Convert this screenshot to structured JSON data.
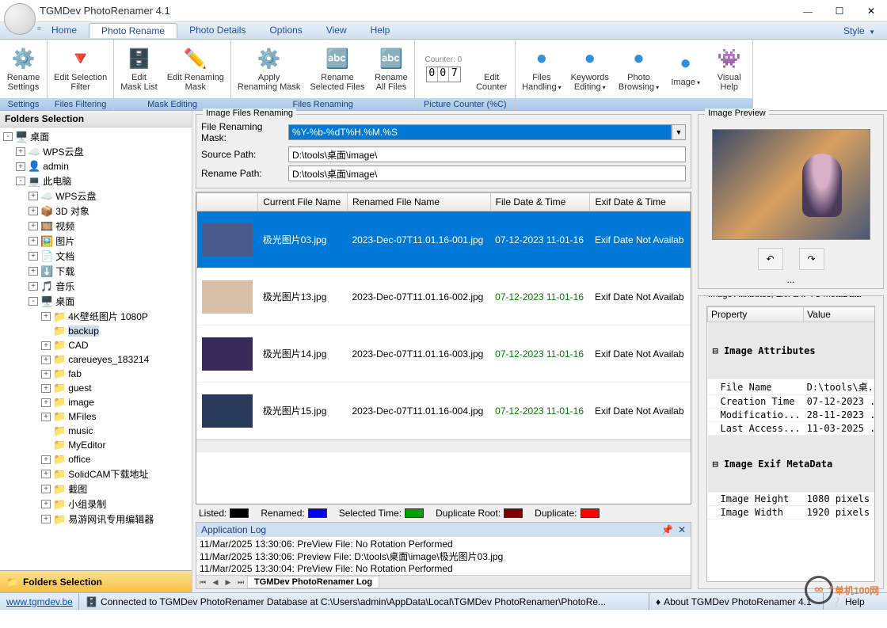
{
  "window": {
    "title": "TGMDev PhotoRenamer 4.1",
    "style_menu": "Style"
  },
  "menu": {
    "items": [
      "Home",
      "Photo Rename",
      "Photo Details",
      "Options",
      "View",
      "Help"
    ],
    "active_index": 1
  },
  "ribbon": {
    "groups": [
      {
        "footer": "Settings",
        "buttons": [
          {
            "name": "rename-settings",
            "icon": "⚙️",
            "label": "Rename\nSettings"
          }
        ]
      },
      {
        "footer": "Files Filtering",
        "buttons": [
          {
            "name": "edit-selection-filter",
            "icon": "🔻",
            "label": "Edit Selection\nFilter",
            "wide": true
          }
        ]
      },
      {
        "footer": "Mask Editing",
        "buttons": [
          {
            "name": "edit-mask-list",
            "icon": "🗄️",
            "label": "Edit\nMask List"
          },
          {
            "name": "edit-renaming-mask",
            "icon": "✏️",
            "label": "Edit Renaming\nMask",
            "wide": true
          }
        ]
      },
      {
        "footer": "Files Renaming",
        "buttons": [
          {
            "name": "apply-renaming-mask",
            "icon": "⚙️",
            "label": "Apply\nRenaming Mask",
            "wide": true
          },
          {
            "name": "rename-selected-files",
            "icon": "🔤",
            "label": "Rename\nSelected Files",
            "wide": true
          },
          {
            "name": "rename-all-files",
            "icon": "🔤",
            "label": "Rename\nAll Files"
          }
        ]
      },
      {
        "footer": "Picture Counter (%C)",
        "counter": {
          "label": "Counter: 0",
          "digits": [
            "0",
            "0",
            "7"
          ]
        },
        "buttons": [
          {
            "name": "edit-counter",
            "icon": "",
            "label": "Edit\nCounter"
          }
        ]
      },
      {
        "footer": "",
        "buttons": [
          {
            "name": "files-handling",
            "icon": "●",
            "label": "Files\nHandling",
            "drop": true,
            "blue": true
          },
          {
            "name": "keywords-editing",
            "icon": "●",
            "label": "Keywords\nEditing",
            "drop": true,
            "blue": true
          },
          {
            "name": "photo-browsing",
            "icon": "●",
            "label": "Photo\nBrowsing",
            "drop": true,
            "blue": true
          },
          {
            "name": "image-menu",
            "icon": "●",
            "label": "Image",
            "drop": true,
            "blue": true
          },
          {
            "name": "visual-help",
            "icon": "👾",
            "label": "Visual\nHelp"
          }
        ]
      }
    ]
  },
  "folders": {
    "header": "Folders Selection",
    "handle": "Folders Selection",
    "tree": [
      {
        "d": 0,
        "t": "-",
        "ic": "🖥️",
        "l": "桌面"
      },
      {
        "d": 1,
        "t": "+",
        "ic": "☁️",
        "l": "WPS云盘"
      },
      {
        "d": 1,
        "t": "+",
        "ic": "👤",
        "l": "admin"
      },
      {
        "d": 1,
        "t": "-",
        "ic": "💻",
        "l": "此电脑"
      },
      {
        "d": 2,
        "t": "+",
        "ic": "☁️",
        "l": "WPS云盘"
      },
      {
        "d": 2,
        "t": "+",
        "ic": "📦",
        "l": "3D 对象"
      },
      {
        "d": 2,
        "t": "+",
        "ic": "🎞️",
        "l": "视频"
      },
      {
        "d": 2,
        "t": "+",
        "ic": "🖼️",
        "l": "图片"
      },
      {
        "d": 2,
        "t": "+",
        "ic": "📄",
        "l": "文档"
      },
      {
        "d": 2,
        "t": "+",
        "ic": "⬇️",
        "l": "下载"
      },
      {
        "d": 2,
        "t": "+",
        "ic": "🎵",
        "l": "音乐"
      },
      {
        "d": 2,
        "t": "-",
        "ic": "🖥️",
        "l": "桌面"
      },
      {
        "d": 3,
        "t": "+",
        "ic": "📁",
        "l": "4K壁纸图片 1080P"
      },
      {
        "d": 3,
        "t": "",
        "ic": "📁",
        "l": "backup",
        "sel": true
      },
      {
        "d": 3,
        "t": "+",
        "ic": "📁",
        "l": "CAD"
      },
      {
        "d": 3,
        "t": "+",
        "ic": "📁",
        "l": "careueyes_183214"
      },
      {
        "d": 3,
        "t": "+",
        "ic": "📁",
        "l": "fab"
      },
      {
        "d": 3,
        "t": "+",
        "ic": "📁",
        "l": "guest"
      },
      {
        "d": 3,
        "t": "+",
        "ic": "📁",
        "l": "image"
      },
      {
        "d": 3,
        "t": "+",
        "ic": "📁",
        "l": "MFiles"
      },
      {
        "d": 3,
        "t": "",
        "ic": "📁",
        "l": "music"
      },
      {
        "d": 3,
        "t": "",
        "ic": "📁",
        "l": "MyEditor"
      },
      {
        "d": 3,
        "t": "+",
        "ic": "📁",
        "l": "office"
      },
      {
        "d": 3,
        "t": "+",
        "ic": "📁",
        "l": "SolidCAM下载地址"
      },
      {
        "d": 3,
        "t": "+",
        "ic": "📁",
        "l": "截图"
      },
      {
        "d": 3,
        "t": "+",
        "ic": "📁",
        "l": "小组录制"
      },
      {
        "d": 3,
        "t": "+",
        "ic": "📁",
        "l": "易游网讯专用编辑器"
      }
    ]
  },
  "renaming": {
    "legend": "Image Files Renaming",
    "mask_label": "File Renaming Mask:",
    "mask_value": "%Y-%b-%dT%H.%M.%S",
    "source_label": "Source Path:",
    "source_value": "D:\\tools\\桌面\\image\\",
    "rename_label": "Rename Path:",
    "rename_value": "D:\\tools\\桌面\\image\\"
  },
  "table": {
    "columns": [
      "",
      "Current File Name",
      "Renamed File Name",
      "File Date & Time",
      "Exif Date & Time"
    ],
    "rows": [
      {
        "current": "极光图片03.jpg",
        "renamed": "2023-Dec-07T11.01.16-001.jpg",
        "fdate": "07-12-2023 11-01-16",
        "exif": "Exif Date Not Availab",
        "selected": true,
        "thumb": "#4a5a8a"
      },
      {
        "current": "极光图片13.jpg",
        "renamed": "2023-Dec-07T11.01.16-002.jpg",
        "fdate": "07-12-2023 11-01-16",
        "exif": "Exif Date Not Availab",
        "thumb": "#d8c0a8"
      },
      {
        "current": "极光图片14.jpg",
        "renamed": "2023-Dec-07T11.01.16-003.jpg",
        "fdate": "07-12-2023 11-01-16",
        "exif": "Exif Date Not Availab",
        "thumb": "#3a2a5a"
      },
      {
        "current": "极光图片15.jpg",
        "renamed": "2023-Dec-07T11.01.16-004.jpg",
        "fdate": "07-12-2023 11-01-16",
        "exif": "Exif Date Not Availab",
        "thumb": "#2a3a5a"
      }
    ]
  },
  "legend": [
    {
      "label": "Listed:",
      "color": "#000000"
    },
    {
      "label": "Renamed:",
      "color": "#0000ff"
    },
    {
      "label": "Selected Time:",
      "color": "#00a000"
    },
    {
      "label": "Duplicate Root:",
      "color": "#800000"
    },
    {
      "label": "Duplicate:",
      "color": "#ff0000"
    }
  ],
  "log": {
    "header": "Application Log",
    "lines": [
      "11/Mar/2025 13:30:06: PreView File: No Rotation Performed",
      "11/Mar/2025 13:30:06: Preview File: D:\\tools\\桌面\\image\\极光图片03.jpg",
      "11/Mar/2025 13:30:04: PreView File: No Rotation Performed"
    ],
    "tab": "TGMDev PhotoRenamer Log"
  },
  "preview": {
    "legend": "Image Preview",
    "ellipsis": "...",
    "attr_legend": "Image Attributes, Exif & IPTC MetaData",
    "attr_headers": [
      "Property",
      "Value"
    ],
    "sections": [
      {
        "title": "Image Attributes",
        "rows": [
          {
            "k": "File Name",
            "v": "D:\\tools\\桌..."
          },
          {
            "k": "Creation Time",
            "v": "07-12-2023 ..."
          },
          {
            "k": "Modificatio...",
            "v": "28-11-2023 ..."
          },
          {
            "k": "Last Access...",
            "v": "11-03-2025 ..."
          }
        ]
      },
      {
        "title": "Image Exif MetaData",
        "rows": [
          {
            "k": "Image Height",
            "v": "1080 pixels"
          },
          {
            "k": "Image Width",
            "v": "1920 pixels"
          }
        ]
      }
    ]
  },
  "status": {
    "url": "www.tgmdev.be",
    "db": "Connected to TGMDev PhotoRenamer Database at C:\\Users\\admin\\AppData\\Local\\TGMDev PhotoRenamer\\PhotoRe...",
    "about": "About TGMDev PhotoRenamer 4.1",
    "help": "Help"
  },
  "watermark": "单机100网"
}
